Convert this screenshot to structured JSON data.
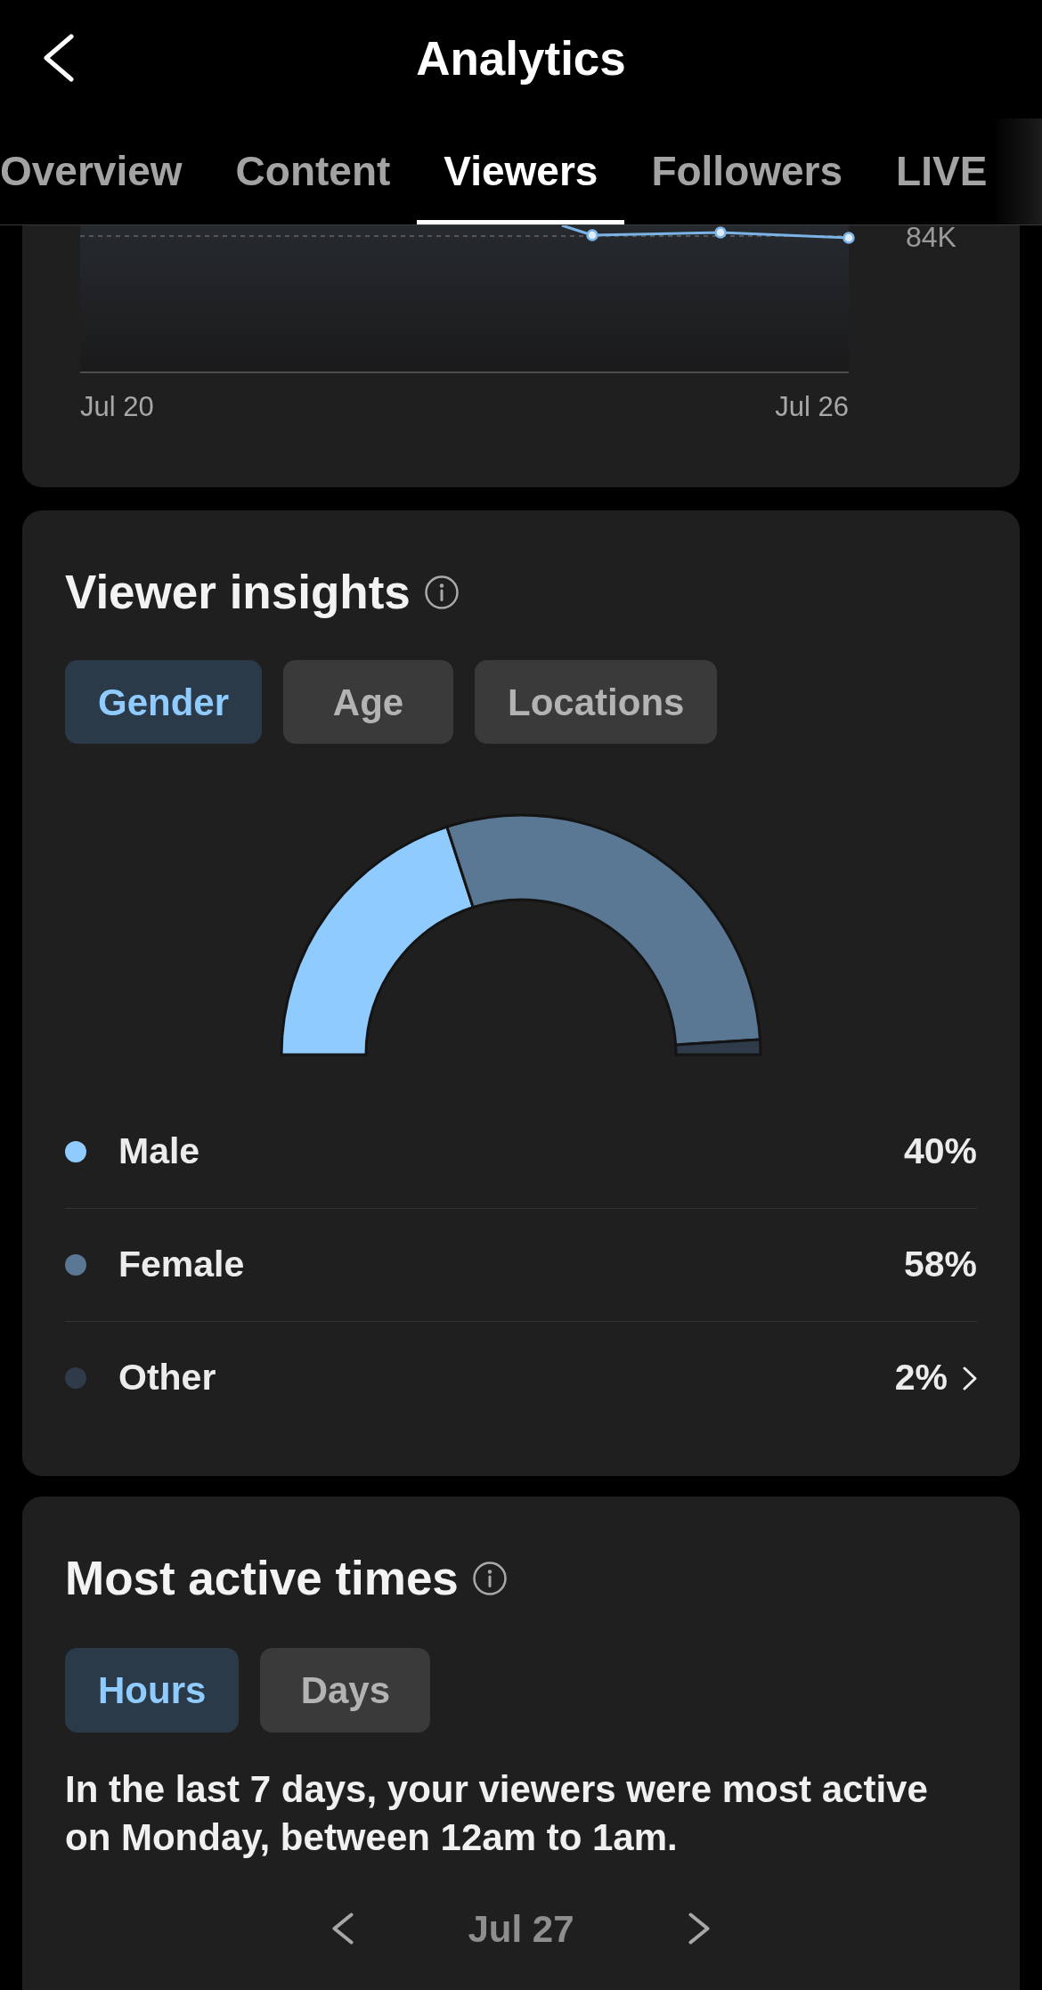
{
  "header": {
    "title": "Analytics"
  },
  "tabs": [
    {
      "label": "Overview",
      "selected": false
    },
    {
      "label": "Content",
      "selected": false
    },
    {
      "label": "Viewers",
      "selected": true
    },
    {
      "label": "Followers",
      "selected": false
    },
    {
      "label": "LIVE",
      "selected": false
    }
  ],
  "trend_chart": {
    "y_labels": [
      "84K"
    ],
    "x_labels": [
      "Jul 20",
      "Jul 26"
    ]
  },
  "viewer_insights": {
    "title": "Viewer insights",
    "filters": [
      {
        "label": "Gender",
        "selected": true
      },
      {
        "label": "Age",
        "selected": false
      },
      {
        "label": "Locations",
        "selected": false
      }
    ],
    "chart_data": {
      "type": "donut",
      "categories": [
        "Male",
        "Female",
        "Other"
      ],
      "values": [
        40,
        58,
        2
      ]
    },
    "legend": [
      {
        "value": "40%",
        "color": "#8fcbff",
        "expandable": false
      },
      {
        "value": "58%",
        "color": "#5a7793",
        "expandable": false
      },
      {
        "value": "2%",
        "color": "#2f3b48",
        "expandable": true
      }
    ]
  },
  "most_active_times": {
    "title": "Most active times",
    "filters": [
      {
        "label": "Hours",
        "selected": true
      },
      {
        "label": "Days",
        "selected": false
      }
    ],
    "summary": "In the last 7 days, your viewers were most active on Monday, between 12am to 1am.",
    "date": "Jul 27"
  }
}
